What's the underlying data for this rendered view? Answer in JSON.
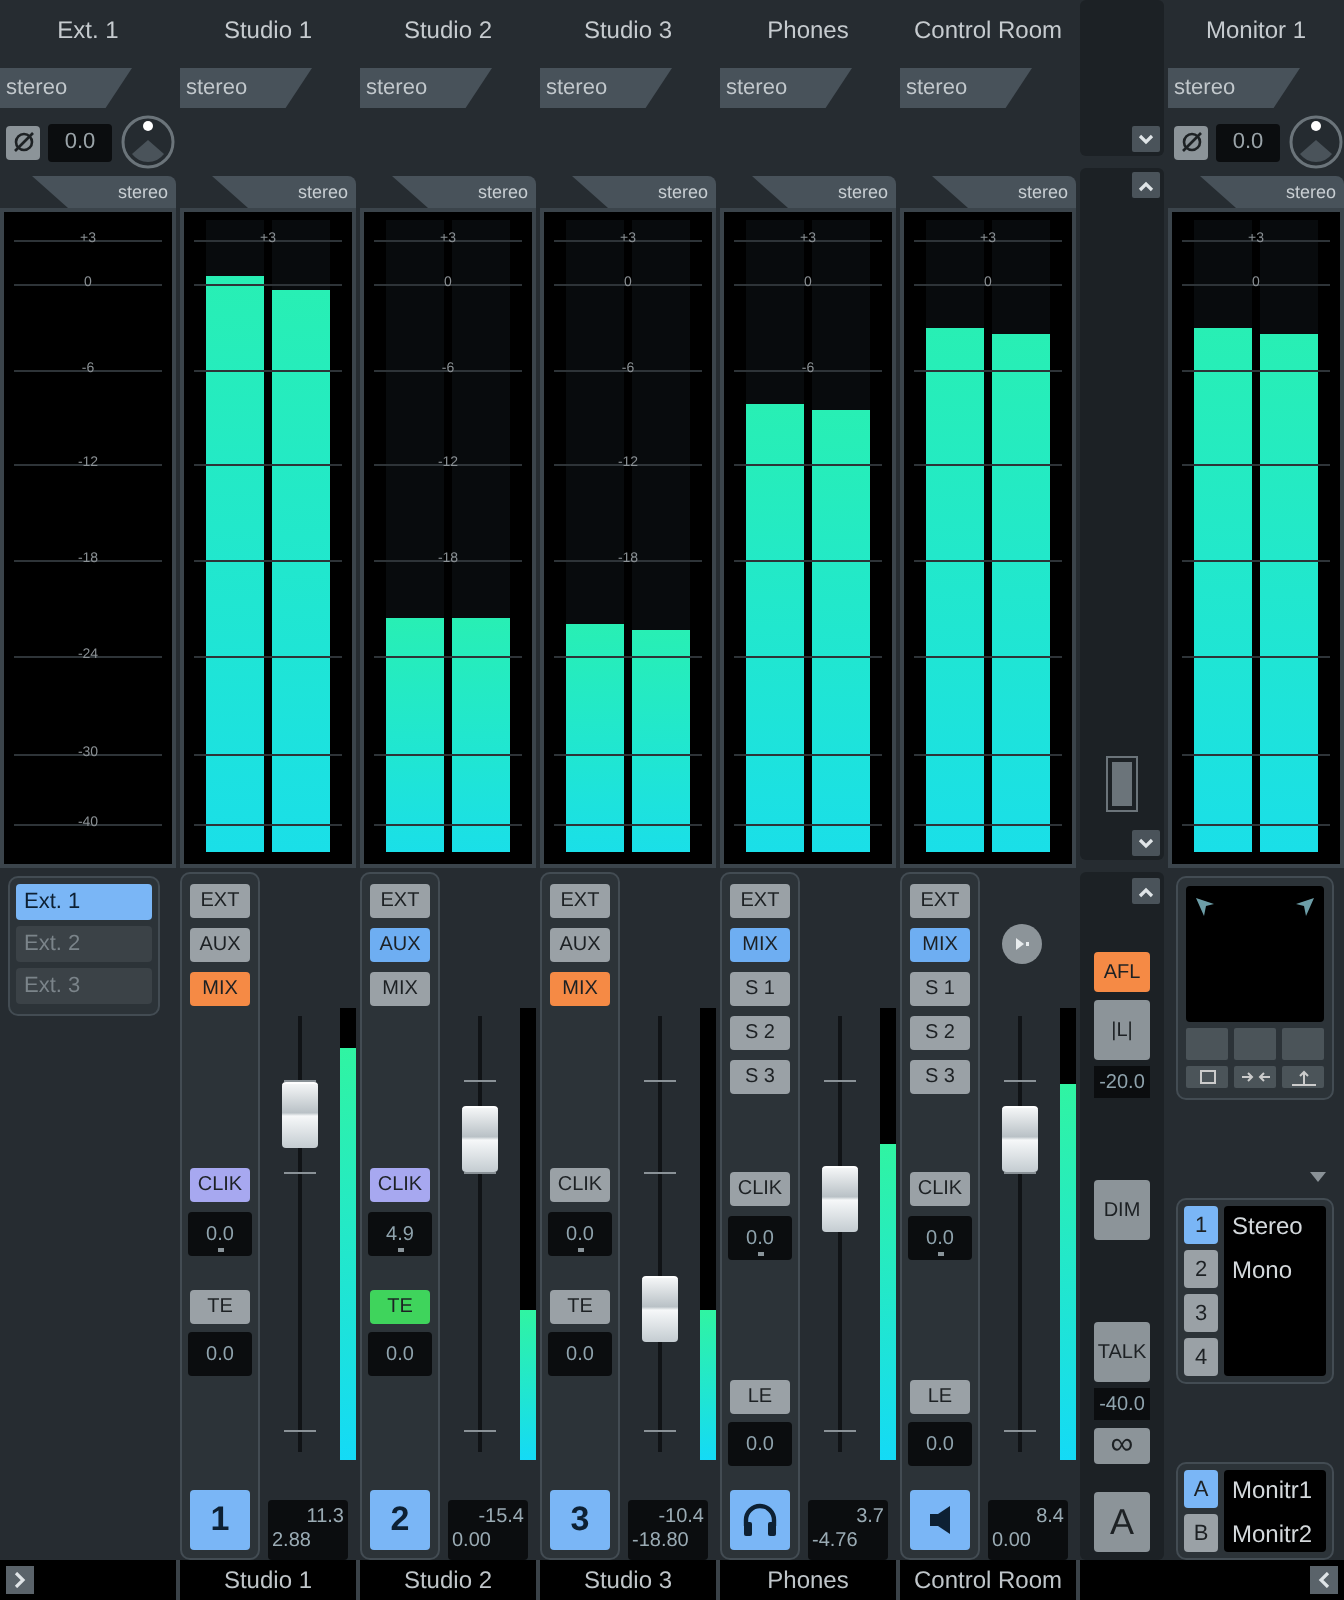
{
  "columns": [
    {
      "kind": "ext",
      "name": "Ext. 1",
      "input_format": "stereo",
      "phase_inverted": false,
      "gain": "0.0",
      "meter_format": "stereo",
      "scale": [
        "+3",
        "0",
        "-6",
        "-12",
        "-18",
        "-24",
        "-30",
        "-40"
      ],
      "sources": [
        {
          "label": "Ext. 1",
          "selected": true
        },
        {
          "label": "Ext. 2",
          "selected": false
        },
        {
          "label": "Ext. 3",
          "selected": false
        }
      ]
    },
    {
      "kind": "cue",
      "name": "Studio 1",
      "input_format": "stereo",
      "meter_format": "stereo",
      "scale": [
        "+3"
      ],
      "levels": [
        {
          "level": 0.91
        },
        {
          "level": 0.89
        }
      ],
      "routes": [
        {
          "label": "EXT",
          "selected": false
        },
        {
          "label": "AUX",
          "selected": false
        },
        {
          "label": "MIX",
          "selected": true,
          "color": "#f58a45"
        }
      ],
      "click": {
        "label": "CLIK",
        "on": true,
        "value": "0.0"
      },
      "extra": {
        "label": "TE",
        "on": false,
        "value": "0.0"
      },
      "fader": {
        "level": 0.82
      },
      "meter": {
        "level": 0.91
      },
      "badge": {
        "kind": "number",
        "label": "1"
      },
      "readout": [
        "11.3",
        "2.88"
      ]
    },
    {
      "kind": "cue",
      "name": "Studio 2",
      "input_format": "stereo",
      "meter_format": "stereo",
      "scale": [
        "+3",
        "0",
        "-6",
        "-12",
        "-18"
      ],
      "levels": [
        {
          "level": 0.37
        },
        {
          "level": 0.37
        }
      ],
      "routes": [
        {
          "label": "EXT",
          "selected": false
        },
        {
          "label": "AUX",
          "selected": true,
          "color": "#6eaef2"
        },
        {
          "label": "MIX",
          "selected": false
        }
      ],
      "click": {
        "label": "CLIK",
        "on": true,
        "value": "4.9"
      },
      "extra": {
        "label": "TE",
        "on": true,
        "value": "0.0"
      },
      "fader": {
        "level": 0.76
      },
      "meter": {
        "level": 0.33
      },
      "badge": {
        "kind": "number",
        "label": "2"
      },
      "readout": [
        "-15.4",
        "0.00"
      ]
    },
    {
      "kind": "cue",
      "name": "Studio 3",
      "input_format": "stereo",
      "meter_format": "stereo",
      "scale": [
        "+3",
        "0",
        "-6",
        "-12",
        "-18"
      ],
      "levels": [
        {
          "level": 0.36
        },
        {
          "level": 0.35
        }
      ],
      "routes": [
        {
          "label": "EXT",
          "selected": false
        },
        {
          "label": "AUX",
          "selected": false
        },
        {
          "label": "MIX",
          "selected": true,
          "color": "#f58a45"
        }
      ],
      "click": {
        "label": "CLIK",
        "on": false,
        "value": "0.0"
      },
      "extra": {
        "label": "TE",
        "on": false,
        "value": "0.0"
      },
      "fader": {
        "level": 0.31
      },
      "meter": {
        "level": 0.33
      },
      "badge": {
        "kind": "number",
        "label": "3"
      },
      "readout": [
        "-10.4",
        "-18.80"
      ]
    },
    {
      "kind": "cue",
      "name": "Phones",
      "input_format": "stereo",
      "meter_format": "stereo",
      "scale": [
        "+3",
        "0",
        "-6"
      ],
      "levels": [
        {
          "level": 0.71
        },
        {
          "level": 0.7
        }
      ],
      "routes": [
        {
          "label": "EXT",
          "selected": false
        },
        {
          "label": "MIX",
          "selected": true,
          "color": "#6eaef2"
        },
        {
          "label": "S 1",
          "selected": false
        },
        {
          "label": "S 2",
          "selected": false
        },
        {
          "label": "S 3",
          "selected": false
        }
      ],
      "click": {
        "label": "CLIK",
        "on": false,
        "value": "0.0"
      },
      "extra": {
        "label": "LE",
        "on": false,
        "value": "0.0"
      },
      "fader": {
        "level": 0.6
      },
      "meter": {
        "level": 0.7
      },
      "badge": {
        "kind": "headphones"
      },
      "readout": [
        "3.7",
        "-4.76"
      ]
    },
    {
      "kind": "cue",
      "name": "Control Room",
      "input_format": "stereo",
      "meter_format": "stereo",
      "scale": [
        "+3",
        "0"
      ],
      "levels": [
        {
          "level": 0.83
        },
        {
          "level": 0.82
        }
      ],
      "routes": [
        {
          "label": "EXT",
          "selected": false
        },
        {
          "label": "MIX",
          "selected": true,
          "color": "#6eaef2"
        },
        {
          "label": "S 1",
          "selected": false
        },
        {
          "label": "S 2",
          "selected": false
        },
        {
          "label": "S 3",
          "selected": false
        }
      ],
      "click": {
        "label": "CLIK",
        "on": false,
        "value": "0.0"
      },
      "extra": {
        "label": "LE",
        "on": false,
        "value": "0.0"
      },
      "fader": {
        "level": 0.76
      },
      "meter": {
        "level": 0.83
      },
      "badge": {
        "kind": "speaker"
      },
      "readout": [
        "8.4",
        "0.00"
      ],
      "play_button": true
    },
    {
      "kind": "center"
    },
    {
      "kind": "monitor",
      "name": "Monitor 1",
      "input_format": "stereo",
      "phase_inverted": false,
      "gain": "0.0",
      "meter_format": "stereo",
      "scale": [
        "+3",
        "0"
      ],
      "levels": [
        {
          "level": 0.83
        },
        {
          "level": 0.82
        }
      ]
    }
  ],
  "control_panel": [
    {
      "kind": "button",
      "label": "AFL",
      "on": true
    },
    {
      "kind": "tall",
      "label": "|L|",
      "on": false
    },
    {
      "kind": "value",
      "label": "-20.0"
    },
    {
      "kind": "gap"
    },
    {
      "kind": "tall",
      "label": "DIM",
      "on": false
    },
    {
      "kind": "gap"
    },
    {
      "kind": "tall",
      "label": "TALK",
      "on": false
    },
    {
      "kind": "value",
      "label": "-40.0"
    },
    {
      "kind": "button",
      "label": "∞",
      "on": false
    },
    {
      "kind": "big",
      "label": "A",
      "on": false
    }
  ],
  "presets": [
    {
      "number": "1",
      "name": "Stereo",
      "selected": true
    },
    {
      "number": "2",
      "name": "Mono",
      "selected": false
    },
    {
      "number": "3",
      "selected": false
    },
    {
      "number": "4",
      "selected": false
    }
  ],
  "monitors": [
    {
      "letter": "A",
      "name": "Monitr1",
      "selected": true
    },
    {
      "letter": "B",
      "name": "Monitr2",
      "selected": false
    }
  ],
  "footer": [
    "Studio 1",
    "Studio 2",
    "Studio 3",
    "Phones",
    "Control Room"
  ]
}
